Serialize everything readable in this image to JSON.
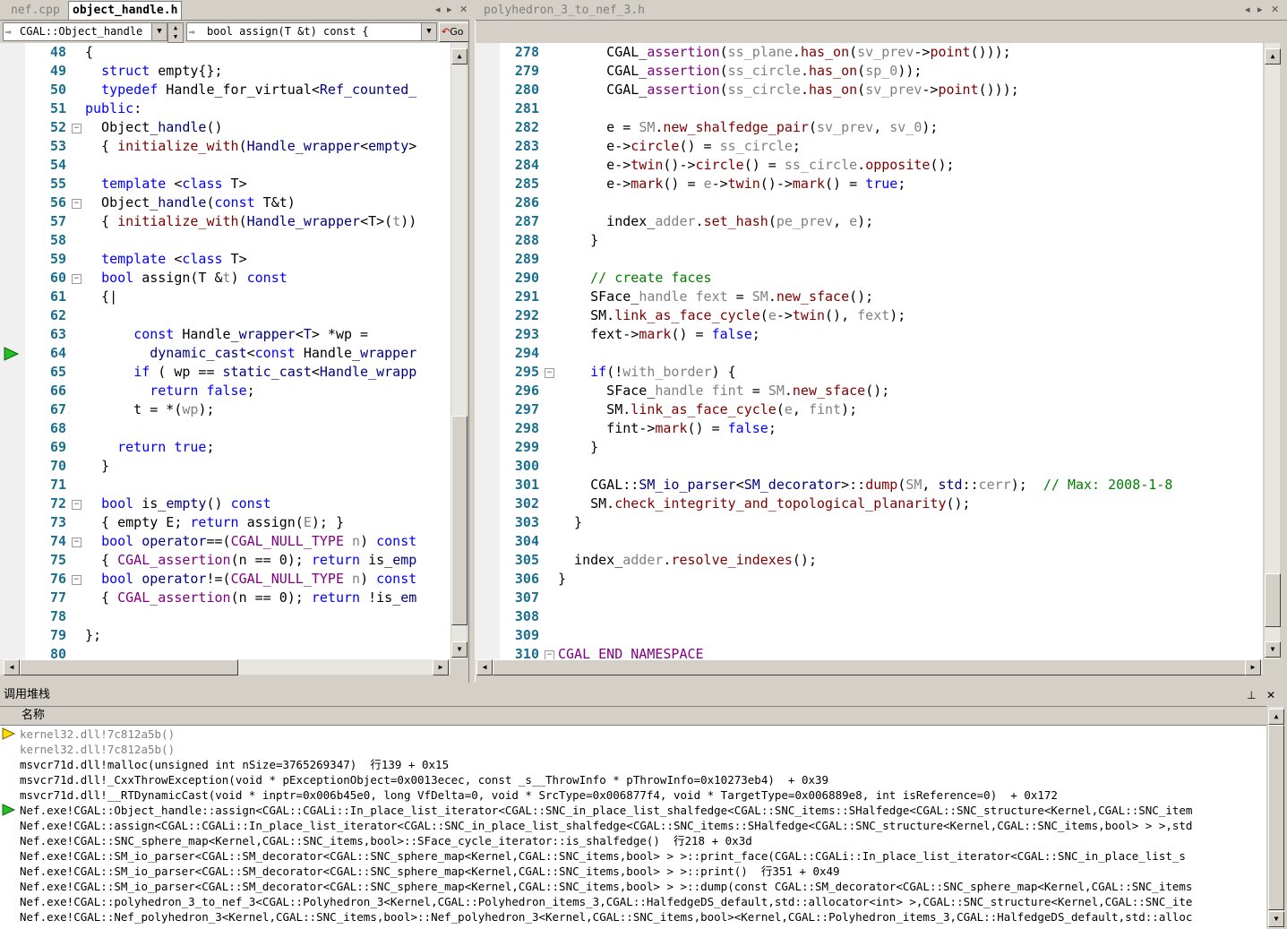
{
  "left_tabs": [
    {
      "label": "nef.cpp",
      "active": false
    },
    {
      "label": "object_handle.h",
      "active": true
    }
  ],
  "right_tabs": [
    {
      "label": "polyhedron_3_to_nef_3.h",
      "active": true
    }
  ],
  "tab_controls": {
    "prev": "◂",
    "next": "▸",
    "close": "✕"
  },
  "nav": {
    "scope_combo": "CGAL::Object_handle",
    "member_combo": "bool assign(T &t) const     {",
    "go_button": "Go"
  },
  "left_editor": {
    "current_line": 64,
    "lines": [
      {
        "n": "48",
        "html": "<span>{</span>"
      },
      {
        "n": "49",
        "html": "  <span class=\"k\">struct</span> empty{};"
      },
      {
        "n": "50",
        "html": "  <span class=\"k\">typedef</span> Handle_for_virtual&lt;<span class=\"t\">Ref_counted_</span>"
      },
      {
        "n": "51",
        "html": "<span class=\"k\">public</span>:"
      },
      {
        "n": "52",
        "html": "  Object_<span class=\"t\">handle</span>()",
        "fold": true
      },
      {
        "n": "53",
        "html": "  { <span class=\"f\">initialize_with</span>(<span class=\"t\">Handle_wrapper</span>&lt;<span class=\"t\">empty</span>&gt;"
      },
      {
        "n": "54",
        "html": ""
      },
      {
        "n": "55",
        "html": "  <span class=\"k\">template</span> &lt;<span class=\"k\">class</span> T&gt;"
      },
      {
        "n": "56",
        "html": "  Object_<span class=\"t\">handle</span>(<span class=\"k\">const</span> T&amp;t)",
        "fold": true
      },
      {
        "n": "57",
        "html": "  { <span class=\"f\">initialize_with</span>(<span class=\"t\">Handle_wrapper</span>&lt;T&gt;(<span class=\"g\">t</span>))"
      },
      {
        "n": "58",
        "html": ""
      },
      {
        "n": "59",
        "html": "  <span class=\"k\">template</span> &lt;<span class=\"k\">class</span> T&gt;"
      },
      {
        "n": "60",
        "html": "  <span class=\"k\">bool</span> assign(T &amp;<span class=\"g\">t</span>) <span class=\"k\">const</span>",
        "fold": true
      },
      {
        "n": "61",
        "html": "  {|"
      },
      {
        "n": "62",
        "html": ""
      },
      {
        "n": "63",
        "html": "      <span class=\"k\">const</span> Handle_<span class=\"t\">wrapper</span>&lt;<span class=\"t\">T</span>&gt; *wp ="
      },
      {
        "n": "64",
        "html": "        <span class=\"t\">dynamic_cast</span>&lt;<span class=\"k\">const</span> Handle_<span class=\"t\">wrapper</span>"
      },
      {
        "n": "65",
        "html": "      <span class=\"k\">if</span> ( wp == <span class=\"t\">static_cast</span>&lt;<span class=\"t\">Handle_wrapp</span>"
      },
      {
        "n": "66",
        "html": "        <span class=\"k\">return</span> <span class=\"k\">false</span>;"
      },
      {
        "n": "67",
        "html": "      t = *(<span class=\"g\">wp</span>);"
      },
      {
        "n": "68",
        "html": ""
      },
      {
        "n": "69",
        "html": "    <span class=\"k\">return</span> <span class=\"k\">true</span>;"
      },
      {
        "n": "70",
        "html": "  }"
      },
      {
        "n": "71",
        "html": ""
      },
      {
        "n": "72",
        "html": "  <span class=\"k\">bool</span> is_<span class=\"t\">empty</span>() <span class=\"k\">const</span>",
        "fold": true
      },
      {
        "n": "73",
        "html": "  { empty E; <span class=\"k\">return</span> assign(<span class=\"g\">E</span>); }"
      },
      {
        "n": "74",
        "html": "  <span class=\"k\">bool</span> <span class=\"t\">operator</span>==(<span class=\"m\">CGAL_NULL_TYPE</span> <span class=\"g\">n</span>) <span class=\"k\">const</span>",
        "fold": true
      },
      {
        "n": "75",
        "html": "  { <span class=\"m\">CGAL_assertion</span>(n == 0); <span class=\"k\">return</span> is_<span class=\"t\">emp</span>"
      },
      {
        "n": "76",
        "html": "  <span class=\"k\">bool</span> <span class=\"t\">operator</span>!=(<span class=\"m\">CGAL_NULL_TYPE</span> <span class=\"g\">n</span>) <span class=\"k\">const</span>",
        "fold": true
      },
      {
        "n": "77",
        "html": "  { <span class=\"m\">CGAL_assertion</span>(n == 0); <span class=\"k\">return</span> !is_<span class=\"t\">em</span>"
      },
      {
        "n": "78",
        "html": ""
      },
      {
        "n": "79",
        "html": "};"
      },
      {
        "n": "80",
        "html": ""
      }
    ]
  },
  "right_editor": {
    "lines": [
      {
        "n": "278",
        "html": "      CGAL_<span class=\"m\">assertion</span>(<span class=\"g\">ss_plane</span>.<span class=\"f\">has_on</span>(<span class=\"g\">sv_prev</span>-&gt;<span class=\"f\">point</span>()));"
      },
      {
        "n": "279",
        "html": "      CGAL_<span class=\"m\">assertion</span>(<span class=\"g\">ss_circle</span>.<span class=\"f\">has_on</span>(<span class=\"g\">sp_0</span>));"
      },
      {
        "n": "280",
        "html": "      CGAL_<span class=\"m\">assertion</span>(<span class=\"g\">ss_circle</span>.<span class=\"f\">has_on</span>(<span class=\"g\">sv_prev</span>-&gt;<span class=\"f\">point</span>()));"
      },
      {
        "n": "281",
        "html": ""
      },
      {
        "n": "282",
        "html": "      e = <span class=\"g\">SM</span>.<span class=\"f\">new_shalfedge_pair</span>(<span class=\"g\">sv_prev</span>, <span class=\"g\">sv_0</span>);"
      },
      {
        "n": "283",
        "html": "      e-&gt;<span class=\"f\">circle</span>() = <span class=\"g\">ss_circle</span>;"
      },
      {
        "n": "284",
        "html": "      e-&gt;<span class=\"f\">twin</span>()-&gt;<span class=\"f\">circle</span>() = <span class=\"g\">ss_circle</span>.<span class=\"f\">opposite</span>();"
      },
      {
        "n": "285",
        "html": "      e-&gt;<span class=\"f\">mark</span>() = <span class=\"g\">e</span>-&gt;<span class=\"f\">twin</span>()-&gt;<span class=\"f\">mark</span>() = <span class=\"k\">true</span>;"
      },
      {
        "n": "286",
        "html": ""
      },
      {
        "n": "287",
        "html": "      index_<span class=\"g\">adder</span>.<span class=\"f\">set_hash</span>(<span class=\"g\">pe_prev</span>, <span class=\"g\">e</span>);"
      },
      {
        "n": "288",
        "html": "    }"
      },
      {
        "n": "289",
        "html": ""
      },
      {
        "n": "290",
        "html": "    <span class=\"c\">// create faces</span>"
      },
      {
        "n": "291",
        "html": "    SFace_<span class=\"g\">handle fext</span> = <span class=\"g\">SM</span>.<span class=\"f\">new_sface</span>();"
      },
      {
        "n": "292",
        "html": "    SM.<span class=\"f\">link_as_face_cycle</span>(<span class=\"g\">e</span>-&gt;<span class=\"f\">twin</span>(), <span class=\"g\">fext</span>);"
      },
      {
        "n": "293",
        "html": "    fext-&gt;<span class=\"f\">mark</span>() = <span class=\"k\">false</span>;"
      },
      {
        "n": "294",
        "html": ""
      },
      {
        "n": "295",
        "html": "    <span class=\"k\">if</span>(!<span class=\"g\">with_border</span>) {",
        "fold": true
      },
      {
        "n": "296",
        "html": "      SFace_<span class=\"g\">handle fint</span> = <span class=\"g\">SM</span>.<span class=\"f\">new_sface</span>();"
      },
      {
        "n": "297",
        "html": "      SM.<span class=\"f\">link_as_face_cycle</span>(<span class=\"g\">e</span>, <span class=\"g\">fint</span>);"
      },
      {
        "n": "298",
        "html": "      fint-&gt;<span class=\"f\">mark</span>() = <span class=\"k\">false</span>;"
      },
      {
        "n": "299",
        "html": "    }"
      },
      {
        "n": "300",
        "html": ""
      },
      {
        "n": "301",
        "html": "    CGAL::<span class=\"t\">SM_io_parser</span>&lt;<span class=\"t\">SM_decorator</span>&gt;::<span class=\"f\">dump</span>(<span class=\"g\">SM</span>, <span class=\"t\">std</span>::<span class=\"g\">cerr</span>);  <span class=\"c\">// Max: 2008-1-8</span>"
      },
      {
        "n": "302",
        "html": "    SM.<span class=\"f\">check_integrity_and_topological_planarity</span>();"
      },
      {
        "n": "303",
        "html": "  }"
      },
      {
        "n": "304",
        "html": ""
      },
      {
        "n": "305",
        "html": "  index_<span class=\"g\">adder</span>.<span class=\"f\">resolve_indexes</span>();"
      },
      {
        "n": "306",
        "html": "}"
      },
      {
        "n": "307",
        "html": ""
      },
      {
        "n": "308",
        "html": ""
      },
      {
        "n": "309",
        "html": ""
      },
      {
        "n": "310",
        "html": "<span class=\"m\">CGAL_END_NAMESPACE</span>",
        "fold": true
      }
    ]
  },
  "call_stack": {
    "panel_title": "调用堆栈",
    "column_name": "名称",
    "rows": [
      {
        "text": "kernel32.dll!7c812a5b()",
        "grey": true,
        "marker": "current"
      },
      {
        "text": "kernel32.dll!7c812a5b()",
        "grey": true
      },
      {
        "text": "msvcr71d.dll!malloc(unsigned int nSize=3765269347)  行139 + 0x15"
      },
      {
        "text": "msvcr71d.dll!_CxxThrowException(void * pExceptionObject=0x0013ecec, const _s__ThrowInfo * pThrowInfo=0x10273eb4)  + 0x39"
      },
      {
        "text": "msvcr71d.dll!__RTDynamicCast(void * inptr=0x006b45e0, long VfDelta=0, void * SrcType=0x006877f4, void * TargetType=0x006889e8, int isReference=0)  + 0x172"
      },
      {
        "text": "Nef.exe!CGAL::Object_handle::assign<CGAL::CGALi::In_place_list_iterator<CGAL::SNC_in_place_list_shalfedge<CGAL::SNC_items::SHalfedge<CGAL::SNC_structure<Kernel,CGAL::SNC_item",
        "marker": "frame"
      },
      {
        "text": "Nef.exe!CGAL::assign<CGAL::CGALi::In_place_list_iterator<CGAL::SNC_in_place_list_shalfedge<CGAL::SNC_items::SHalfedge<CGAL::SNC_structure<Kernel,CGAL::SNC_items,bool> > >,std"
      },
      {
        "text": "Nef.exe!CGAL::SNC_sphere_map<Kernel,CGAL::SNC_items,bool>::SFace_cycle_iterator::is_shalfedge()  行218 + 0x3d"
      },
      {
        "text": "Nef.exe!CGAL::SM_io_parser<CGAL::SM_decorator<CGAL::SNC_sphere_map<Kernel,CGAL::SNC_items,bool> > >::print_face(CGAL::CGALi::In_place_list_iterator<CGAL::SNC_in_place_list_s"
      },
      {
        "text": "Nef.exe!CGAL::SM_io_parser<CGAL::SM_decorator<CGAL::SNC_sphere_map<Kernel,CGAL::SNC_items,bool> > >::print()  行351 + 0x49"
      },
      {
        "text": "Nef.exe!CGAL::SM_io_parser<CGAL::SM_decorator<CGAL::SNC_sphere_map<Kernel,CGAL::SNC_items,bool> > >::dump(const CGAL::SM_decorator<CGAL::SNC_sphere_map<Kernel,CGAL::SNC_items"
      },
      {
        "text": "Nef.exe!CGAL::polyhedron_3_to_nef_3<CGAL::Polyhedron_3<Kernel,CGAL::Polyhedron_items_3,CGAL::HalfedgeDS_default,std::allocator<int> >,CGAL::SNC_structure<Kernel,CGAL::SNC_ite"
      },
      {
        "text": "Nef.exe!CGAL::Nef_polyhedron_3<Kernel,CGAL::SNC_items,bool>::Nef_polyhedron_3<Kernel,CGAL::SNC_items,bool><Kernel,CGAL::Polyhedron_items_3,CGAL::HalfedgeDS_default,std::alloc"
      }
    ]
  }
}
